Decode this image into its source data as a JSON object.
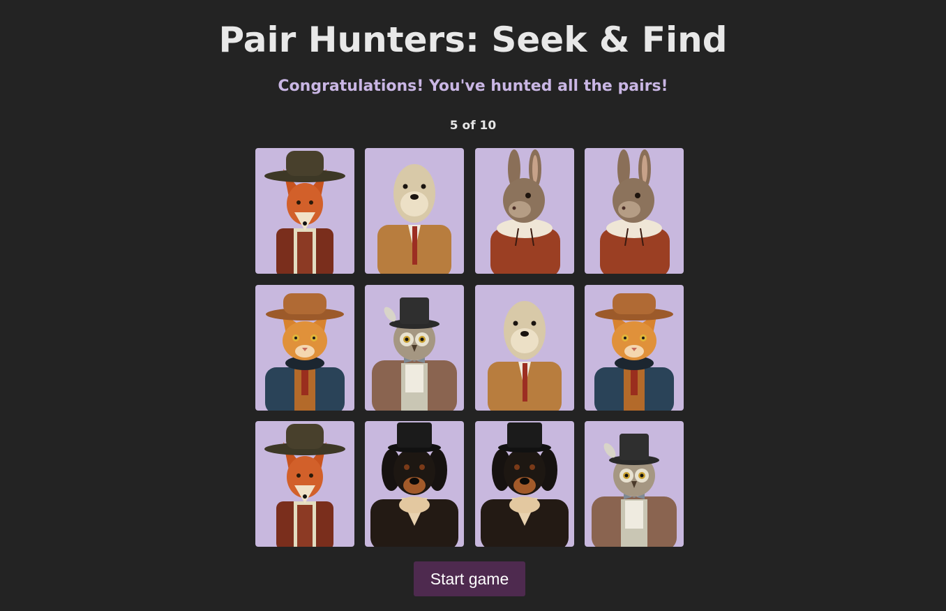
{
  "title": "Pair Hunters: Seek & Find",
  "message": "Congratulations! You've hunted all the pairs!",
  "progress": "5 of 10",
  "start_button": "Start game",
  "colors": {
    "background": "#232323",
    "card_background": "#c8b8de",
    "message": "#c9b6e4",
    "button": "#4e2a4f"
  },
  "cards": [
    {
      "animal": "fox",
      "icon": "fox-in-hat-icon"
    },
    {
      "animal": "otter",
      "icon": "otter-in-suit-icon"
    },
    {
      "animal": "rabbit",
      "icon": "rabbit-in-dress-icon"
    },
    {
      "animal": "rabbit",
      "icon": "rabbit-in-dress-icon"
    },
    {
      "animal": "cat",
      "icon": "cat-in-hat-icon"
    },
    {
      "animal": "owl",
      "icon": "owl-in-top-hat-icon"
    },
    {
      "animal": "otter",
      "icon": "otter-in-suit-icon"
    },
    {
      "animal": "cat",
      "icon": "cat-in-hat-icon"
    },
    {
      "animal": "fox",
      "icon": "fox-in-hat-icon"
    },
    {
      "animal": "dog",
      "icon": "dog-in-top-hat-icon"
    },
    {
      "animal": "dog",
      "icon": "dog-in-top-hat-icon"
    },
    {
      "animal": "owl",
      "icon": "owl-in-top-hat-icon"
    }
  ]
}
